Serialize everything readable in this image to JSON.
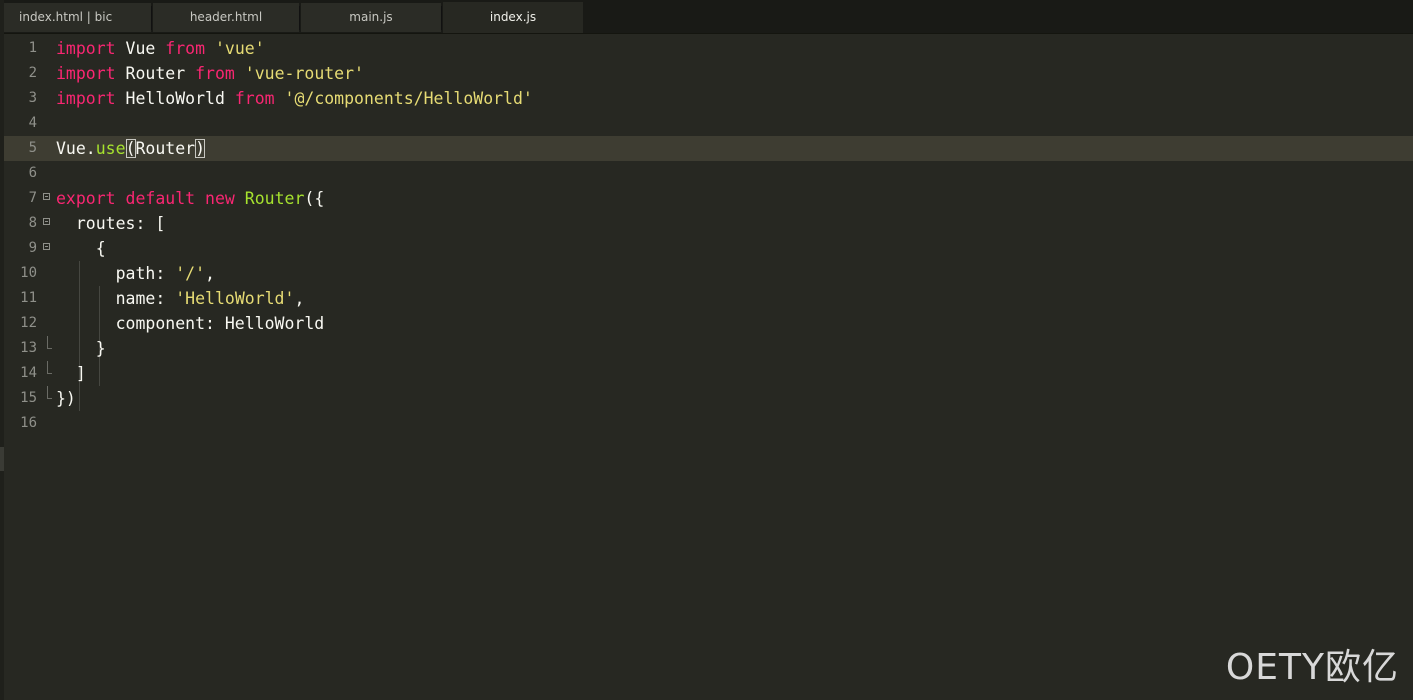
{
  "tabs": [
    {
      "label": "index.html | bic",
      "active": false
    },
    {
      "label": "header.html",
      "active": false
    },
    {
      "label": "main.js",
      "active": false
    },
    {
      "label": "index.js",
      "active": true
    }
  ],
  "code": {
    "lines": [
      {
        "num": "1",
        "tokens": [
          {
            "t": "import",
            "c": "kw"
          },
          {
            "t": " Vue ",
            "c": ""
          },
          {
            "t": "from",
            "c": "kw"
          },
          {
            "t": " ",
            "c": ""
          },
          {
            "t": "'vue'",
            "c": "str"
          }
        ]
      },
      {
        "num": "2",
        "tokens": [
          {
            "t": "import",
            "c": "kw"
          },
          {
            "t": " Router ",
            "c": ""
          },
          {
            "t": "from",
            "c": "kw"
          },
          {
            "t": " ",
            "c": ""
          },
          {
            "t": "'vue-router'",
            "c": "str"
          }
        ]
      },
      {
        "num": "3",
        "tokens": [
          {
            "t": "import",
            "c": "kw"
          },
          {
            "t": " HelloWorld ",
            "c": ""
          },
          {
            "t": "from",
            "c": "kw"
          },
          {
            "t": " ",
            "c": ""
          },
          {
            "t": "'@/components/HelloWorld'",
            "c": "str"
          }
        ]
      },
      {
        "num": "4",
        "tokens": []
      },
      {
        "num": "5",
        "current": true,
        "tokens": [
          {
            "t": "Vue.",
            "c": ""
          },
          {
            "t": "use",
            "c": "fn"
          },
          {
            "t": "(",
            "c": "bracket"
          },
          {
            "t": "Router",
            "c": ""
          },
          {
            "t": ")",
            "c": "bracket"
          }
        ]
      },
      {
        "num": "6",
        "tokens": []
      },
      {
        "num": "7",
        "fold": "open",
        "tokens": [
          {
            "t": "export",
            "c": "kw"
          },
          {
            "t": " ",
            "c": ""
          },
          {
            "t": "default",
            "c": "kw"
          },
          {
            "t": " ",
            "c": ""
          },
          {
            "t": "new",
            "c": "kw"
          },
          {
            "t": " ",
            "c": ""
          },
          {
            "t": "Router",
            "c": "fn"
          },
          {
            "t": "({",
            "c": ""
          }
        ]
      },
      {
        "num": "8",
        "fold": "open",
        "tokens": [
          {
            "t": "  routes: [",
            "c": ""
          }
        ]
      },
      {
        "num": "9",
        "fold": "open",
        "tokens": [
          {
            "t": "    {",
            "c": ""
          }
        ]
      },
      {
        "num": "10",
        "tokens": [
          {
            "t": "      path: ",
            "c": ""
          },
          {
            "t": "'/'",
            "c": "str"
          },
          {
            "t": ",",
            "c": ""
          }
        ]
      },
      {
        "num": "11",
        "tokens": [
          {
            "t": "      name: ",
            "c": ""
          },
          {
            "t": "'HelloWorld'",
            "c": "str"
          },
          {
            "t": ",",
            "c": ""
          }
        ]
      },
      {
        "num": "12",
        "tokens": [
          {
            "t": "      component: HelloWorld",
            "c": ""
          }
        ]
      },
      {
        "num": "13",
        "fold": "end",
        "tokens": [
          {
            "t": "    }",
            "c": ""
          }
        ]
      },
      {
        "num": "14",
        "fold": "end",
        "tokens": [
          {
            "t": "  ]",
            "c": ""
          }
        ]
      },
      {
        "num": "15",
        "fold": "end",
        "tokens": [
          {
            "t": "})",
            "c": ""
          }
        ]
      },
      {
        "num": "16",
        "tokens": []
      }
    ]
  },
  "watermark": "OETY欧亿",
  "colors": {
    "background": "#272822",
    "keyword": "#f92672",
    "string": "#e6db74",
    "function": "#a6e22e",
    "text": "#f8f8f2",
    "current_line": "#3e3d32"
  }
}
